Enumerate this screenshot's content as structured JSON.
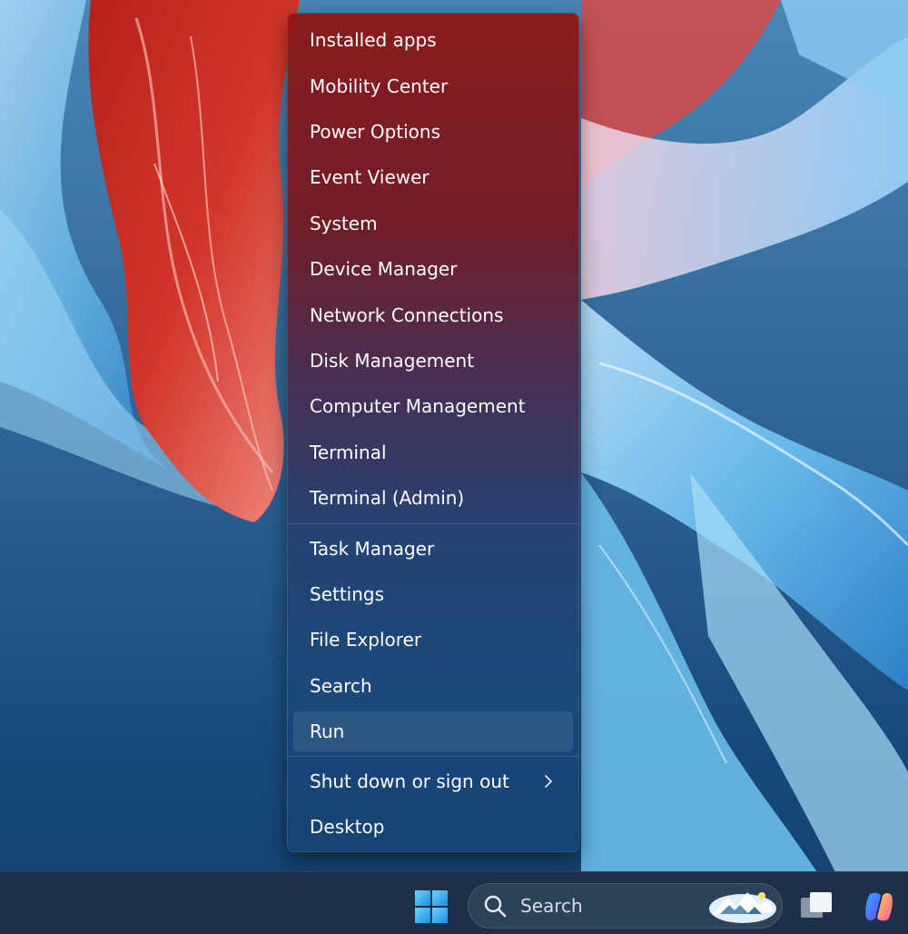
{
  "context_menu": {
    "items": [
      {
        "label": "Installed apps"
      },
      {
        "label": "Mobility Center"
      },
      {
        "label": "Power Options"
      },
      {
        "label": "Event Viewer"
      },
      {
        "label": "System"
      },
      {
        "label": "Device Manager"
      },
      {
        "label": "Network Connections"
      },
      {
        "label": "Disk Management"
      },
      {
        "label": "Computer Management"
      },
      {
        "label": "Terminal"
      },
      {
        "label": "Terminal (Admin)"
      },
      {
        "label": "Task Manager"
      },
      {
        "label": "Settings"
      },
      {
        "label": "File Explorer"
      },
      {
        "label": "Search"
      },
      {
        "label": "Run",
        "hovered": true
      },
      {
        "label": "Shut down or sign out",
        "submenu_icon": "chevron-right-icon"
      },
      {
        "label": "Desktop"
      }
    ]
  },
  "taskbar": {
    "start_icon": "windows-logo-icon",
    "search": {
      "placeholder": "Search",
      "icon": "search-icon",
      "highlight_icon": "search-highlight-mountains-icon"
    },
    "task_view_icon": "task-view-icon",
    "copilot_icon": "copilot-icon"
  },
  "colors": {
    "taskbar": "#1c3148",
    "menu_text": "#ffffff",
    "start_accent": "#3fb6f2"
  }
}
